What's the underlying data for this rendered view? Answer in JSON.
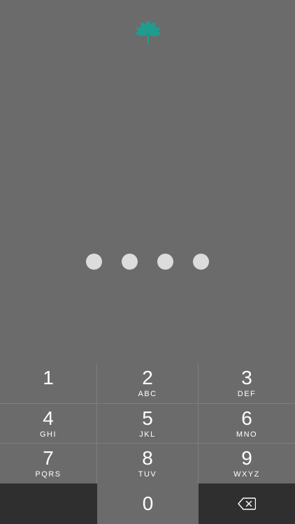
{
  "passcode": {
    "entered_count": 0,
    "dot_count": 4
  },
  "colors": {
    "background": "#6b6b6b",
    "logo_accent": "#1f9c8e",
    "dot": "#dcdcdc",
    "bottom_row": "#2f2f2f"
  },
  "keypad": {
    "keys": [
      {
        "digit": "1",
        "letters": ""
      },
      {
        "digit": "2",
        "letters": "ABC"
      },
      {
        "digit": "3",
        "letters": "DEF"
      },
      {
        "digit": "4",
        "letters": "GHI"
      },
      {
        "digit": "5",
        "letters": "JKL"
      },
      {
        "digit": "6",
        "letters": "MNO"
      },
      {
        "digit": "7",
        "letters": "PQRS"
      },
      {
        "digit": "8",
        "letters": "TUV"
      },
      {
        "digit": "9",
        "letters": "WXYZ"
      }
    ],
    "zero": {
      "digit": "0"
    },
    "delete_icon": "backspace-icon"
  },
  "logo": {
    "icon": "lotus-logo-icon"
  }
}
